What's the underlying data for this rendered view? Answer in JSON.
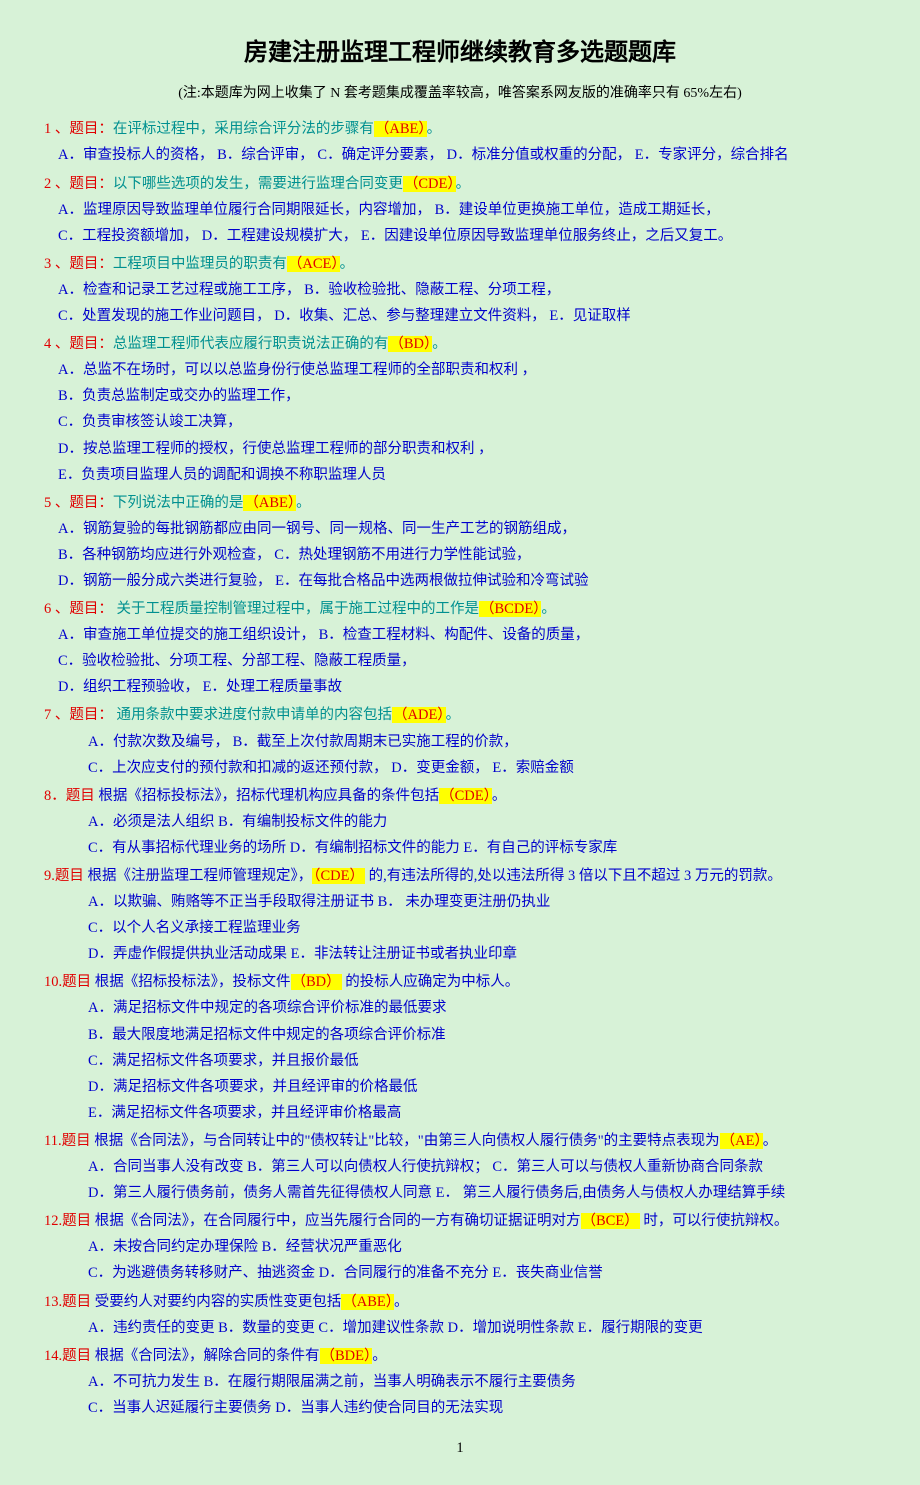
{
  "title": "房建注册监理工程师继续教育多选题题库",
  "subtitle": "(注:本题库为网上收集了 N 套考题集成覆盖率较高，唯答案系网友版的准确率只有 65%左右)",
  "page_number": "1",
  "questions": [
    {
      "num": "1 、题目：",
      "stem_pre": "在评标过程中，采用综合评分法的步骤有",
      "answer": "（ABE）",
      "stem_post": "。",
      "mode": "teal",
      "options_lines": [
        "A．审查投标人的资格，  B．综合评审，  C．确定评分要素，   D．标准分值或权重的分配，  E．专家评分，综合排名"
      ]
    },
    {
      "num": "2 、题目：",
      "stem_pre": "以下哪些选项的发生，需要进行监理合同变更",
      "answer": "（CDE）",
      "stem_post": "。",
      "mode": "teal",
      "options_lines": [
        "A．监理原因导致监理单位履行合同期限延长，内容增加，    B．建设单位更换施工单位，造成工期延长，",
        "C．工程投资额增加，       D．工程建设规模扩大，       E．因建设单位原因导致监理单位服务终止，之后又复工。"
      ]
    },
    {
      "num": "3 、题目：",
      "stem_pre": "工程项目中监理员的职责有",
      "answer": "（ACE）",
      "stem_post": "。",
      "mode": "teal",
      "options_lines": [
        "A．检查和记录工艺过程或施工工序，       B．验收检验批、隐蔽工程、分项工程，",
        "C．处置发现的施工作业问题目，           D．收集、汇总、参与整理建立文件资料，   E．见证取样"
      ]
    },
    {
      "num": "4 、题目：",
      "stem_pre": "总监理工程师代表应履行职责说法正确的有",
      "answer": "（BD）",
      "stem_post": "。",
      "mode": "teal",
      "options_lines": [
        "A．总监不在场时，可以以总监身份行使总监理工程师的全部职责和权利 ，",
        "B．负责总监制定或交办的监理工作，",
        "C．负责审核签认竣工决算，",
        "D．按总监理工程师的授权，行使总监理工程师的部分职责和权利 ，",
        "E．负责项目监理人员的调配和调换不称职监理人员"
      ]
    },
    {
      "num": "5 、题目：",
      "stem_pre": "下列说法中正确的是",
      "answer": "（ABE）",
      "stem_post": "。",
      "mode": "teal",
      "options_lines": [
        "A．钢筋复验的每批钢筋都应由同一钢号、同一规格、同一生产工艺的钢筋组成，",
        "B．各种钢筋均应进行外观检查，      C．热处理钢筋不用进行力学性能试验，",
        "D．钢筋一般分成六类进行复验，      E．在每批合格品中选两根做拉伸试验和冷弯试验"
      ]
    },
    {
      "num": "6 、题目：",
      "stem_pre": "  关于工程质量控制管理过程中，属于施工过程中的工作是",
      "answer": "（BCDE）",
      "stem_post": "。",
      "mode": "teal",
      "options_lines": [
        "A．审查施工单位提交的施工组织设计，                 B．检查工程材料、构配件、设备的质量，",
        "C．验收检验批、分项工程、分部工程、隐蔽工程质量，",
        "D．组织工程预验收，                                 E．处理工程质量事故"
      ]
    },
    {
      "num": "7 、题目：",
      "stem_pre": "  通用条款中要求进度付款申请单的内容包括",
      "answer": "（ADE）",
      "stem_post": "。",
      "mode": "teal",
      "indent": true,
      "options_lines": [
        "A．付款次数及编号，                         B．截至上次付款周期末已实施工程的价款，",
        "C．上次应支付的预付款和扣减的返还预付款，   D．变更金额，                E．索赔金额"
      ]
    },
    {
      "num": "8．题目",
      "stem_pre": "  根据《招标投标法》，招标代理机构应具备的条件包括",
      "answer": "（CDE）",
      "stem_post": "。",
      "mode": "blue",
      "indent": true,
      "options_lines": [
        "A．必须是法人组织           B．有编制投标文件的能力",
        "C．有从事招标代理业务的场所    D．有编制招标文件的能力     E．有自己的评标专家库"
      ]
    },
    {
      "num": "9.题目",
      "stem_pre": "  根据《注册监理工程师管理规定》，",
      "answer": "（CDE）",
      "stem_post": " 的,有违法所得的,处以违法所得 3 倍以下且不超过 3 万元的罚款。",
      "mode": "blue",
      "indent": true,
      "options_lines": [
        "A．以欺骗、贿赂等不正当手段取得注册证书     B．  未办理变更注册仍执业",
        "C．以个人名义承接工程监理业务",
        "D．弄虚作假提供执业活动成果                 E．非法转让注册证书或者执业印章"
      ]
    },
    {
      "num": "10.题目",
      "stem_pre": "   根据《招标投标法》，投标文件",
      "answer": "（BD）",
      "stem_post": " 的投标人应确定为中标人。",
      "mode": "blue",
      "indent": true,
      "options_lines": [
        "A．满足招标文件中规定的各项综合评价标准的最低要求",
        "B．最大限度地满足招标文件中规定的各项综合评价标准",
        "C．满足招标文件各项要求，并且报价最低",
        "D．满足招标文件各项要求，并且经评审的价格最低",
        "E．满足招标文件各项要求，并且经评审价格最高"
      ]
    },
    {
      "num": "11.题目",
      "stem_pre": "   根据《合同法》，与合同转让中的\"债权转让\"比较，\"由第三人向债权人履行债务\"的主要特点表现为",
      "answer": "（AE）",
      "stem_post": "。",
      "mode": "blue",
      "indent": true,
      "options_lines": [
        "A．合同当事人没有改变    B．第三人可以向债权人行使抗辩权；     C．第三人可以与债权人重新协商合同条款",
        "D．第三人履行债务前，债务人需首先征得债权人同意     E．  第三人履行债务后,由债务人与债权人办理结算手续"
      ]
    },
    {
      "num": "12.题目",
      "stem_pre": "   根据《合同法》，在合同履行中，应当先履行合同的一方有确切证据证明对方",
      "answer": "（BCE）",
      "stem_post": " 时，可以行使抗辩权。",
      "mode": "blue",
      "indent": true,
      "options_lines": [
        "A．未按合同约定办理保险               B．经营状况严重恶化",
        "C．为逃避债务转移财产、抽逃资金    D．合同履行的准备不充分           E．丧失商业信誉"
      ]
    },
    {
      "num": "13.题目",
      "stem_pre": "   受要约人对要约内容的实质性变更包括",
      "answer": "（ABE）",
      "stem_post": "。",
      "mode": "blue",
      "indent": true,
      "options_lines": [
        "A．违约责任的变更    B．数量的变更    C．增加建议性条款    D．增加说明性条款   E．履行期限的变更"
      ]
    },
    {
      "num": "14.题目",
      "stem_pre": "   根据《合同法》，解除合同的条件有",
      "answer": "（BDE）",
      "stem_post": "。",
      "mode": "blue",
      "indent": true,
      "options_lines": [
        "A．不可抗力发生           B．在履行期限届满之前，当事人明确表示不履行主要债务",
        "C．当事人迟延履行主要债务      D．当事人违约使合同目的无法实现"
      ]
    }
  ]
}
